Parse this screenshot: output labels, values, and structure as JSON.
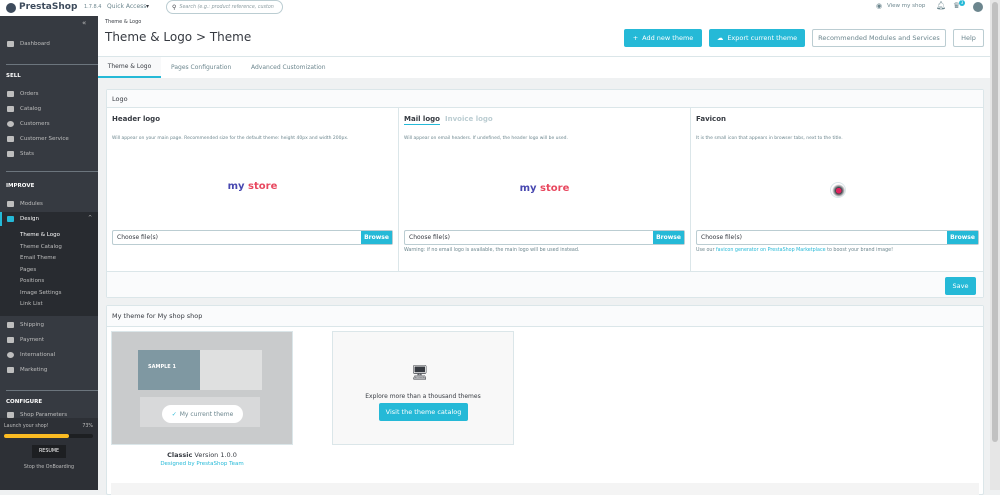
{
  "topbar": {
    "brand": "PrestaShop",
    "version": "1.7.8.4",
    "quick_access": "Quick Access",
    "search_placeholder": "Search (e.g.: product reference, custon",
    "view_shop": "View my shop",
    "notif_count": "3"
  },
  "sidebar": {
    "dashboard": "Dashboard",
    "sell": "SELL",
    "sell_items": [
      "Orders",
      "Catalog",
      "Customers",
      "Customer Service",
      "Stats"
    ],
    "improve": "IMPROVE",
    "modules": "Modules",
    "design": "Design",
    "design_sub": [
      "Theme & Logo",
      "Theme Catalog",
      "Email Theme",
      "Pages",
      "Positions",
      "Image Settings",
      "Link List"
    ],
    "improve_items": [
      "Shipping",
      "Payment",
      "International",
      "Marketing"
    ],
    "configure": "CONFIGURE",
    "configure_first": "Shop Parameters",
    "onboarding": {
      "label": "Launch your shop!",
      "percent_text": "73%",
      "progress": 0.73,
      "resume": "RESUME",
      "stop": "Stop the OnBoarding"
    }
  },
  "header": {
    "breadcrumb": "Theme & Logo",
    "title": "Theme & Logo > Theme",
    "add_theme": "Add new theme",
    "export_theme": "Export current theme",
    "recommended": "Recommended Modules and Services",
    "help": "Help"
  },
  "tabs": [
    "Theme & Logo",
    "Pages Configuration",
    "Advanced Customization"
  ],
  "logo_panel": {
    "title": "Logo",
    "header_logo": {
      "title": "Header logo",
      "desc": "Will appear on your main page. Recommended size for the default theme: height 40px and width 200px.",
      "logo_text_1": "my",
      "logo_text_2": "store",
      "file_placeholder": "Choose file(s)",
      "browse": "Browse"
    },
    "mail_logo": {
      "tab_active": "Mail logo",
      "tab_inactive": "Invoice logo",
      "desc": "Will appear on email headers. If undefined, the header logo will be used.",
      "logo_text_1": "my",
      "logo_text_2": "store",
      "file_placeholder": "Choose file(s)",
      "browse": "Browse",
      "warning": "Warning: if no email logo is available, the main logo will be used instead."
    },
    "favicon": {
      "title": "Favicon",
      "desc": "It is the small icon that appears in browser tabs, next to the title.",
      "file_placeholder": "Choose file(s)",
      "browse": "Browse",
      "note_pre": "Use our ",
      "note_link": "favicon generator on PrestaShop Marketplace",
      "note_post": " to boost your brand image!"
    },
    "save": "Save"
  },
  "theme_panel": {
    "title": "My theme for My shop shop",
    "current_badge": "My current theme",
    "theme_name": "Classic",
    "theme_version": "Version 1.0.0",
    "designer": "Designed by PrestaShop Team",
    "preview_sample": "SAMPLE 1",
    "explore": "Explore more than a thousand themes",
    "visit_catalog": "Visit the theme catalog"
  },
  "colors": {
    "accent": "#25b9d7",
    "sidebar": "#363a41"
  }
}
